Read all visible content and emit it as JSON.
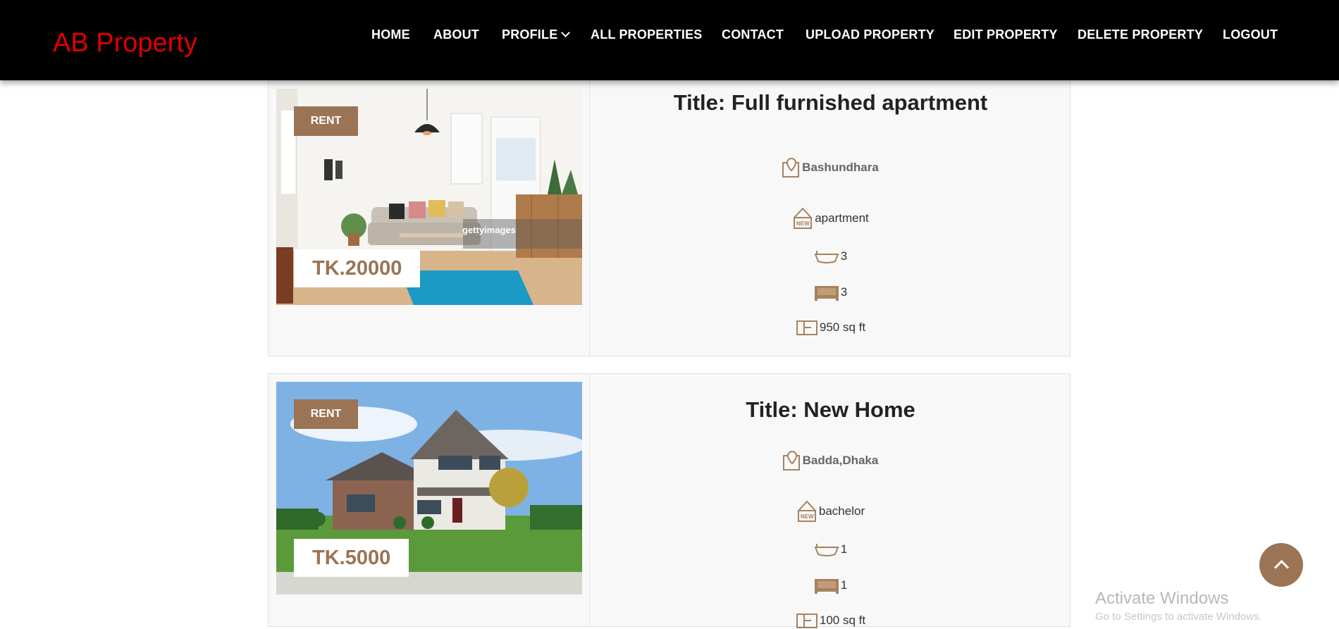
{
  "nav": {
    "brand": "AB Property",
    "items": [
      {
        "label": "HOME"
      },
      {
        "label": "ABOUT"
      },
      {
        "label": "PROFILE"
      },
      {
        "label": "ALL PROPERTIES"
      },
      {
        "label": "CONTACT"
      },
      {
        "label": "UPLOAD PROPERTY"
      },
      {
        "label": "EDIT PROPERTY"
      },
      {
        "label": "DELETE PROPERTY"
      },
      {
        "label": "LOGOUT"
      }
    ]
  },
  "listings": [
    {
      "badge": "RENT",
      "price": "TK.20000",
      "title": "Title: Full furnished apartment",
      "location": "Bashundhara",
      "category": "apartment",
      "baths": "3",
      "beds": "3",
      "area": "950 sq ft"
    },
    {
      "badge": "RENT",
      "price": "TK.5000",
      "title": "Title: New Home",
      "location": "Badda,Dhaka",
      "category": "bachelor",
      "baths": "1",
      "beds": "1",
      "area": "100 sq ft"
    }
  ],
  "photo_captions": {
    "stock_mark": "gettyimages"
  },
  "os_watermark": {
    "line1": "Activate Windows",
    "line2": "Go to Settings to activate Windows."
  },
  "icons": [
    "map-pin-icon",
    "new-home-icon",
    "bathtub-icon",
    "bed-icon",
    "floor-plan-icon",
    "chevron-down-icon",
    "arrow-up-icon"
  ],
  "colors": {
    "accent": "#9a7455",
    "brand": "#e00000",
    "nav_bg": "#000000"
  }
}
